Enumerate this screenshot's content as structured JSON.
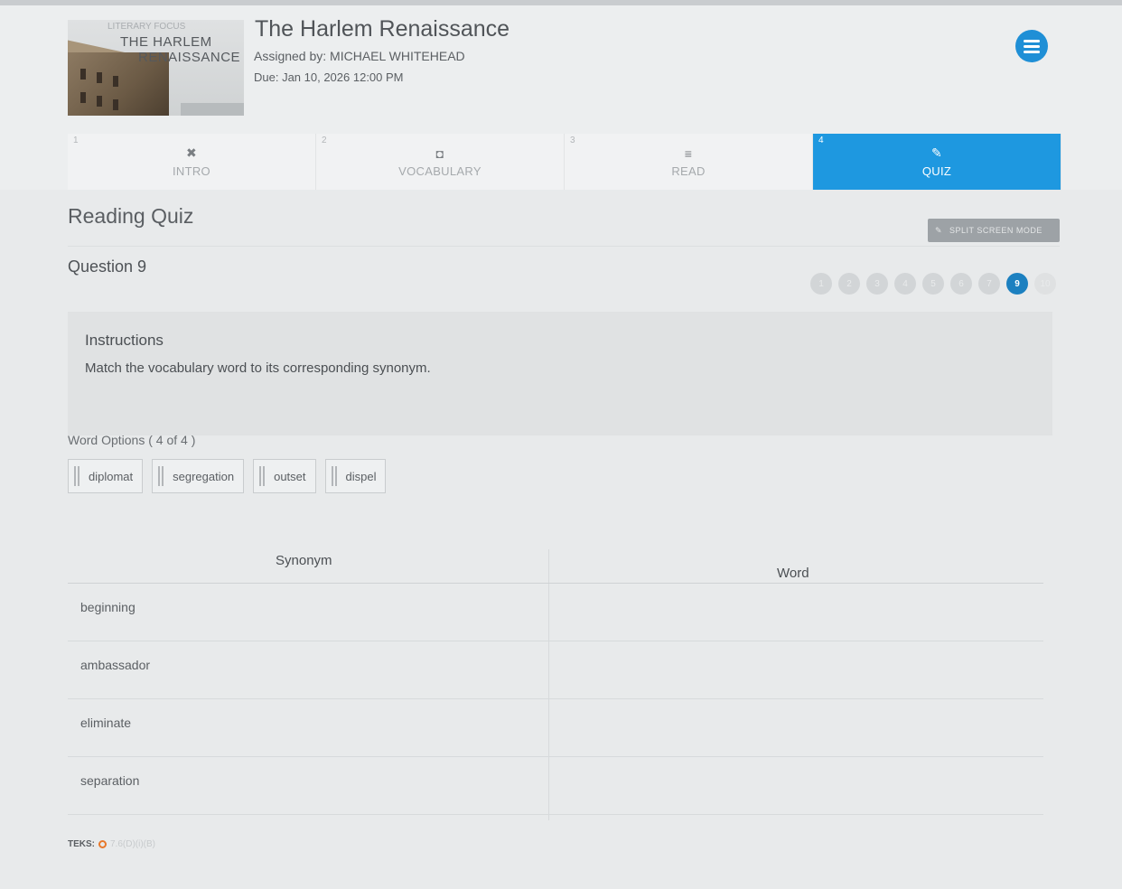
{
  "header": {
    "thumb_kicker": "LITERARY FOCUS",
    "thumb_title_1": "THE HARLEM",
    "thumb_title_2": "RENAISSANCE",
    "title": "The Harlem Renaissance",
    "assigned": "Assigned by: MICHAEL WHITEHEAD",
    "due": "Due: Jan 10, 2026 12:00 PM"
  },
  "tabs": [
    {
      "num": "1",
      "label": "INTRO",
      "icon": "puzzle-icon"
    },
    {
      "num": "2",
      "label": "VOCABULARY",
      "icon": "vocabulary-icon"
    },
    {
      "num": "3",
      "label": "READ",
      "icon": "lines-icon"
    },
    {
      "num": "4",
      "label": "QUIZ",
      "icon": "quiz-icon",
      "active": true
    }
  ],
  "quiz": {
    "heading": "Reading Quiz",
    "split_screen": "SPLIT SCREEN MODE",
    "question_label": "Question 9",
    "progress": [
      "1",
      "2",
      "3",
      "4",
      "5",
      "6",
      "7",
      "8",
      "9",
      "10"
    ],
    "current": "9"
  },
  "instructions": {
    "title": "Instructions",
    "text": "Match the vocabulary word to its corresponding synonym."
  },
  "word_options": {
    "label": "Word Options ( 4 of 4 )",
    "words": [
      "diplomat",
      "segregation",
      "outset",
      "dispel"
    ]
  },
  "table": {
    "col_synonym": "Synonym",
    "col_word": "Word",
    "rows": [
      "beginning",
      "ambassador",
      "eliminate",
      "separation"
    ]
  },
  "footer": {
    "teks_label": "TEKS:",
    "teks_code": "7.6(D)(i)(B)"
  },
  "colors": {
    "accent": "#1e98e0",
    "current_dot": "#1c80c0"
  }
}
